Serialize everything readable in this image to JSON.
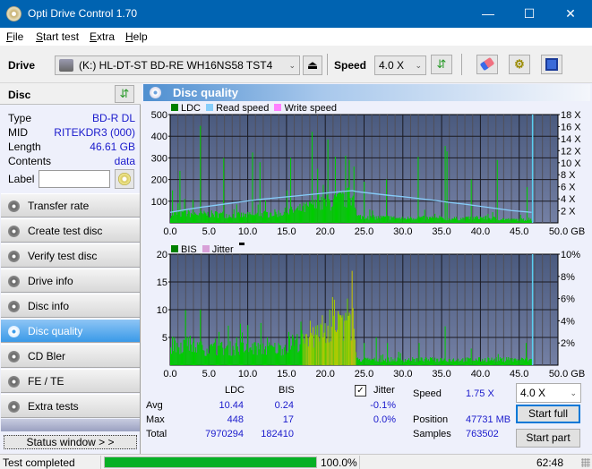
{
  "window": {
    "title": "Opti Drive Control 1.70",
    "minimize": "—",
    "maximize": "☐",
    "close": "✕"
  },
  "menu": [
    {
      "label": "File",
      "accel": "F",
      "rest": "ile"
    },
    {
      "label": "Start test",
      "accel": "S",
      "rest": "tart test"
    },
    {
      "label": "Extra",
      "accel": "E",
      "rest": "xtra"
    },
    {
      "label": "Help",
      "accel": "H",
      "rest": "elp"
    }
  ],
  "toolbar": {
    "drive_label": "Drive",
    "drive_value": "(K:)  HL-DT-ST BD-RE  WH16NS58 TST4",
    "speed_label": "Speed",
    "speed_value": "4.0 X",
    "icons": [
      "drive-icon",
      "eject-icon",
      "refresh-icon",
      "erase-icon",
      "settings-icon",
      "save-icon"
    ]
  },
  "disc": {
    "header": "Disc",
    "rows": [
      {
        "key": "Type",
        "value": "BD-R DL"
      },
      {
        "key": "MID",
        "value": "RITEKDR3 (000)"
      },
      {
        "key": "Length",
        "value": "46.61 GB"
      },
      {
        "key": "Contents",
        "value": "data"
      }
    ],
    "label_key": "Label",
    "label_value": ""
  },
  "nav": [
    {
      "label": "Transfer rate",
      "active": false
    },
    {
      "label": "Create test disc",
      "active": false
    },
    {
      "label": "Verify test disc",
      "active": false
    },
    {
      "label": "Drive info",
      "active": false
    },
    {
      "label": "Disc info",
      "active": false
    },
    {
      "label": "Disc quality",
      "active": true
    },
    {
      "label": "CD Bler",
      "active": false
    },
    {
      "label": "FE / TE",
      "active": false
    },
    {
      "label": "Extra tests",
      "active": false
    }
  ],
  "status_window_label": "Status window > >",
  "panel": {
    "title": "Disc quality"
  },
  "colors": {
    "ldc": "#008000",
    "read_speed": "#87cefa",
    "write_speed": "#ff80ff",
    "bis": "#008000",
    "jitter": "#d8a0d8",
    "bar_green": "#00cc00",
    "bar_yellow": "#aacc00",
    "plot_bg_top": "#4a5a7e",
    "plot_bg_bottom": "#7480a4",
    "progress": "#06b025",
    "accent": "#0078d7"
  },
  "chart_data": [
    {
      "type": "bar",
      "title": "LDC / Read speed",
      "legend": [
        "LDC",
        "Read speed",
        "Write speed"
      ],
      "legend_position": "top-left",
      "xlabel": "GB",
      "x_ticks": [
        "0.0",
        "5.0",
        "10.0",
        "15.0",
        "20.0",
        "25.0",
        "30.0",
        "35.0",
        "40.0",
        "45.0",
        "50.0 GB"
      ],
      "y_ticks_left": [
        "500",
        "400",
        "300",
        "200",
        "100"
      ],
      "y_ticks_right": [
        "18 X",
        "16 X",
        "14 X",
        "12 X",
        "10 X",
        "8 X",
        "6 X",
        "4 X",
        "2 X"
      ],
      "xlim": [
        0,
        50
      ],
      "ylim": [
        0,
        500
      ],
      "y2lim": [
        0,
        18
      ],
      "grid": true,
      "disc_end_gb": 46.61,
      "ldc_baseline": [
        [
          0,
          40
        ],
        [
          2,
          45
        ],
        [
          4,
          40
        ],
        [
          6,
          40
        ],
        [
          8,
          35
        ],
        [
          10,
          35
        ],
        [
          12,
          40
        ],
        [
          14,
          45
        ],
        [
          16,
          55
        ],
        [
          18,
          75
        ],
        [
          20,
          90
        ],
        [
          22,
          110
        ],
        [
          23.5,
          120
        ],
        [
          24,
          30
        ],
        [
          26,
          25
        ],
        [
          28,
          25
        ],
        [
          30,
          20
        ],
        [
          32,
          25
        ],
        [
          34,
          20
        ],
        [
          36,
          20
        ],
        [
          38,
          20
        ],
        [
          40,
          25
        ],
        [
          42,
          20
        ],
        [
          44,
          15
        ],
        [
          46.6,
          15
        ]
      ],
      "ldc_spikes": [
        [
          0.2,
          150
        ],
        [
          1.2,
          240
        ],
        [
          1.8,
          110
        ],
        [
          3.8,
          448
        ],
        [
          6.8,
          300
        ],
        [
          10.6,
          325
        ],
        [
          11.5,
          280
        ],
        [
          15.0,
          150
        ],
        [
          15.5,
          300
        ],
        [
          18.2,
          420
        ],
        [
          19.0,
          250
        ],
        [
          20.3,
          385
        ],
        [
          21.2,
          305
        ],
        [
          22.6,
          310
        ],
        [
          23.0,
          290
        ],
        [
          23.7,
          260
        ],
        [
          25.0,
          190
        ],
        [
          27.8,
          200
        ],
        [
          31.9,
          305
        ],
        [
          35.4,
          355
        ],
        [
          35.6,
          330
        ],
        [
          38.7,
          200
        ],
        [
          42.1,
          290
        ],
        [
          46.0,
          165
        ]
      ],
      "read_speed": [
        [
          0,
          1.75
        ],
        [
          2,
          2.2
        ],
        [
          4,
          2.6
        ],
        [
          6,
          2.95
        ],
        [
          8,
          3.3
        ],
        [
          10,
          3.65
        ],
        [
          12,
          3.95
        ],
        [
          14,
          4.2
        ],
        [
          16,
          4.45
        ],
        [
          18,
          4.7
        ],
        [
          20,
          4.95
        ],
        [
          22,
          5.2
        ],
        [
          23.5,
          5.35
        ],
        [
          24,
          5.2
        ],
        [
          26,
          4.9
        ],
        [
          28,
          4.6
        ],
        [
          30,
          4.35
        ],
        [
          32,
          4.05
        ],
        [
          34,
          3.75
        ],
        [
          36,
          3.4
        ],
        [
          38,
          3.1
        ],
        [
          40,
          2.75
        ],
        [
          42,
          2.4
        ],
        [
          44,
          2.05
        ],
        [
          46.6,
          1.75
        ]
      ]
    },
    {
      "type": "bar",
      "title": "BIS / Jitter",
      "legend": [
        "BIS",
        "Jitter"
      ],
      "legend_position": "top-left",
      "xlabel": "GB",
      "x_ticks": [
        "0.0",
        "5.0",
        "10.0",
        "15.0",
        "20.0",
        "25.0",
        "30.0",
        "35.0",
        "40.0",
        "45.0",
        "50.0 GB"
      ],
      "y_ticks_left": [
        "20",
        "15",
        "10",
        "5"
      ],
      "y_ticks_right": [
        "10%",
        "8%",
        "6%",
        "4%",
        "2%"
      ],
      "xlim": [
        0,
        50
      ],
      "ylim": [
        0,
        20
      ],
      "y2lim": [
        0,
        10
      ],
      "grid": true,
      "disc_end_gb": 46.61,
      "bis_baseline": [
        [
          0,
          3
        ],
        [
          2,
          4
        ],
        [
          4,
          3
        ],
        [
          6,
          3
        ],
        [
          8,
          3
        ],
        [
          10,
          3
        ],
        [
          12,
          3
        ],
        [
          14,
          3
        ],
        [
          16,
          4
        ],
        [
          18,
          5
        ],
        [
          20,
          6
        ],
        [
          22,
          7
        ],
        [
          23.5,
          8
        ],
        [
          24,
          1
        ],
        [
          26,
          1
        ],
        [
          28,
          1
        ],
        [
          30,
          1
        ],
        [
          32,
          1
        ],
        [
          34,
          1
        ],
        [
          36,
          1
        ],
        [
          38,
          1
        ],
        [
          40,
          1
        ],
        [
          42,
          1
        ],
        [
          44,
          1
        ],
        [
          46.6,
          1
        ]
      ],
      "bis_spikes": [
        [
          0.5,
          5
        ],
        [
          2.0,
          5
        ],
        [
          3.8,
          10
        ],
        [
          6.2,
          6
        ],
        [
          8.5,
          5
        ],
        [
          12.5,
          5
        ],
        [
          15.2,
          6
        ],
        [
          18.0,
          8
        ],
        [
          19.5,
          9
        ],
        [
          20.5,
          10
        ],
        [
          22.0,
          9
        ],
        [
          22.8,
          12
        ],
        [
          23.4,
          17
        ],
        [
          25.0,
          4
        ],
        [
          26.5,
          5
        ],
        [
          28.0,
          4
        ],
        [
          32.0,
          4
        ],
        [
          35.4,
          7
        ],
        [
          38.8,
          3
        ],
        [
          42.2,
          2
        ],
        [
          45.8,
          4
        ]
      ]
    }
  ],
  "stats": {
    "col_ldc": "LDC",
    "col_bis": "BIS",
    "rows": [
      {
        "label": "Avg",
        "ldc": "10.44",
        "bis": "0.24",
        "jitter": "-0.1%"
      },
      {
        "label": "Max",
        "ldc": "448",
        "bis": "17",
        "jitter": "0.0%"
      },
      {
        "label": "Total",
        "ldc": "7970294",
        "bis": "182410"
      }
    ],
    "jitter_label": "Jitter",
    "jitter_checked": true,
    "speed_label": "Speed",
    "speed_value": "1.75 X",
    "position_label": "Position",
    "position_value": "47731 MB",
    "samples_label": "Samples",
    "samples_value": "763502",
    "speed_select": "4.0 X",
    "start_full": "Start full",
    "start_part": "Start part"
  },
  "statusbar": {
    "status": "Test completed",
    "progress_pct": 100.0,
    "progress_text": "100.0%",
    "time": "62:48"
  }
}
